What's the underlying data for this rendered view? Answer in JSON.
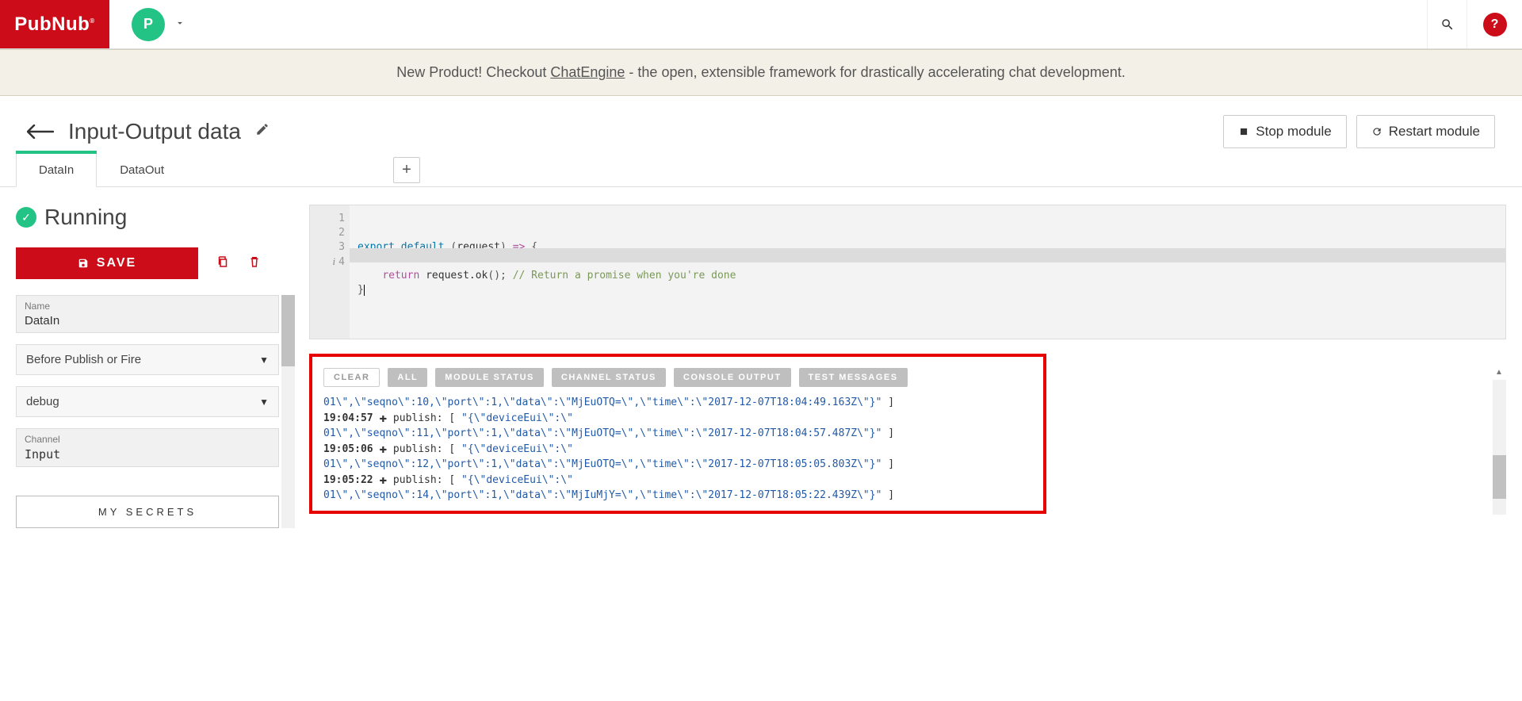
{
  "brand": "PubNub",
  "avatar_letter": "P",
  "notice": {
    "prefix": "New Product! Checkout ",
    "link": "ChatEngine",
    "suffix": " - the open, extensible framework for drastically accelerating chat development."
  },
  "page_title": "Input-Output data",
  "buttons": {
    "stop": "Stop module",
    "restart": "Restart module",
    "save": "SAVE",
    "secrets": "MY SECRETS"
  },
  "tabs": [
    "DataIn",
    "DataOut"
  ],
  "active_tab": 0,
  "status": "Running",
  "form": {
    "name_label": "Name",
    "name_value": "DataIn",
    "event_select": "Before Publish or Fire",
    "debug_select": "debug",
    "channel_label": "Channel",
    "channel_value": "Input"
  },
  "code": {
    "lines": [
      "export default (request) => {",
      "",
      "    return request.ok(); // Return a promise when you're done",
      "}"
    ],
    "line_numbers": [
      "1",
      "2",
      "3",
      "4"
    ]
  },
  "console": {
    "buttons": [
      "CLEAR",
      "ALL",
      "MODULE STATUS",
      "CHANNEL STATUS",
      "CONSOLE OUTPUT",
      "TEST MESSAGES"
    ],
    "rows": [
      {
        "type": "payload",
        "text": "01\\\",\\\"seqno\\\":10,\\\"port\\\":1,\\\"data\\\":\\\"MjEuOTQ=\\\",\\\"time\\\":\\\"2017-12-07T18:04:49.163Z\\\"}\" ]"
      },
      {
        "type": "publish",
        "time": "19:04:57",
        "text": "publish: [ \"{\\\"deviceEui\\\":\\\""
      },
      {
        "type": "payload",
        "text": "01\\\",\\\"seqno\\\":11,\\\"port\\\":1,\\\"data\\\":\\\"MjEuOTQ=\\\",\\\"time\\\":\\\"2017-12-07T18:04:57.487Z\\\"}\" ]"
      },
      {
        "type": "publish",
        "time": "19:05:06",
        "text": "publish: [ \"{\\\"deviceEui\\\":\\\""
      },
      {
        "type": "payload",
        "text": "01\\\",\\\"seqno\\\":12,\\\"port\\\":1,\\\"data\\\":\\\"MjEuOTQ=\\\",\\\"time\\\":\\\"2017-12-07T18:05:05.803Z\\\"}\" ]"
      },
      {
        "type": "publish",
        "time": "19:05:22",
        "text": "publish: [ \"{\\\"deviceEui\\\":\\\""
      },
      {
        "type": "payload",
        "text": "01\\\",\\\"seqno\\\":14,\\\"port\\\":1,\\\"data\\\":\\\"MjIuMjY=\\\",\\\"time\\\":\\\"2017-12-07T18:05:22.439Z\\\"}\" ]"
      }
    ]
  }
}
